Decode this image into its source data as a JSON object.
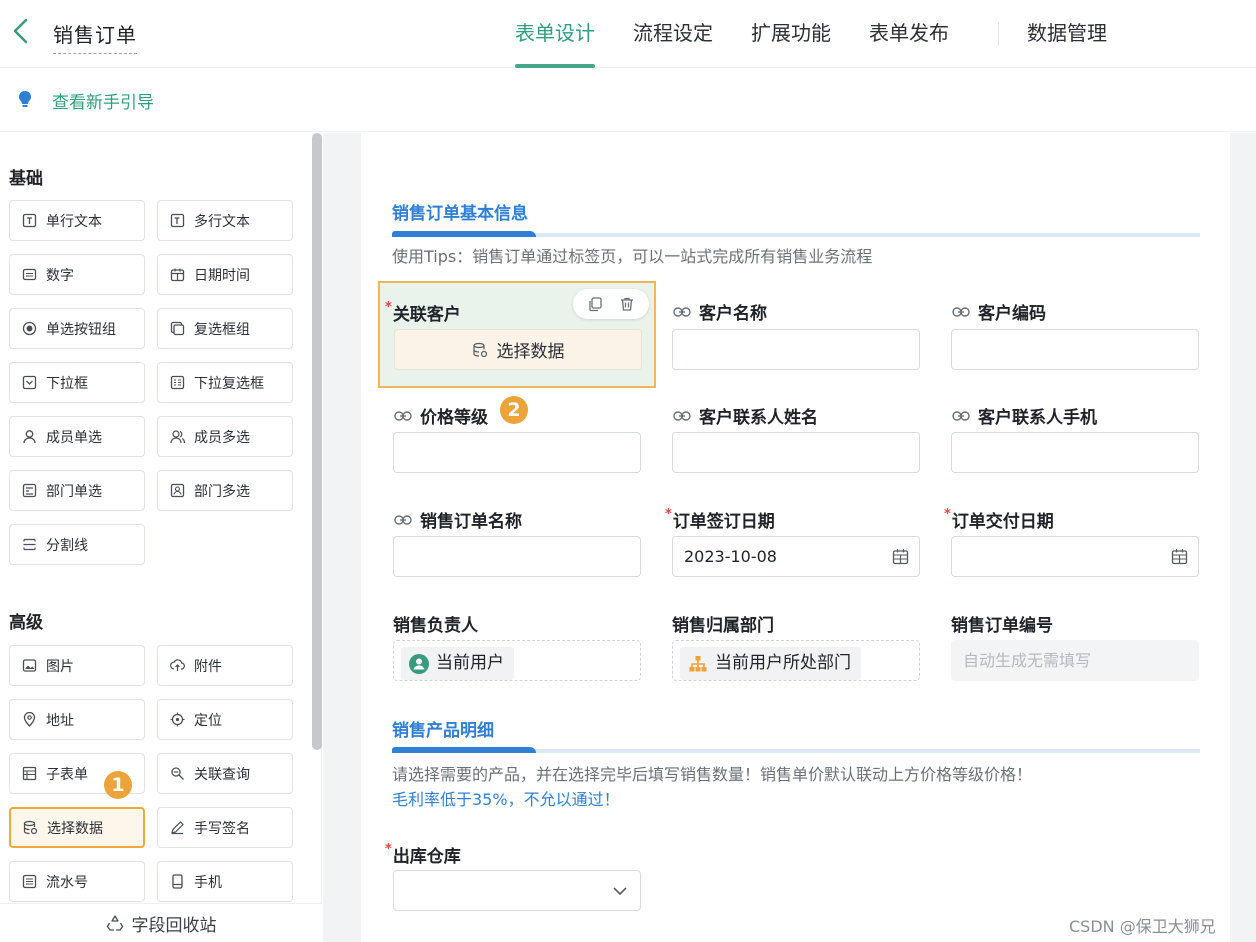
{
  "header": {
    "title": "销售订单",
    "tabs": [
      {
        "label": "表单设计",
        "active": true
      },
      {
        "label": "流程设定"
      },
      {
        "label": "扩展功能"
      },
      {
        "label": "表单发布"
      }
    ],
    "data_tab": "数据管理"
  },
  "guide": {
    "text": "查看新手引导"
  },
  "sidebar": {
    "basic_title": "基础",
    "basic_items": [
      {
        "label": "单行文本",
        "icon": "textbox-icon"
      },
      {
        "label": "多行文本",
        "icon": "textarea-icon"
      },
      {
        "label": "数字",
        "icon": "number-icon"
      },
      {
        "label": "日期时间",
        "icon": "calendar-icon"
      },
      {
        "label": "单选按钮组",
        "icon": "radio-icon"
      },
      {
        "label": "复选框组",
        "icon": "checkbox-group-icon"
      },
      {
        "label": "下拉框",
        "icon": "dropdown-icon"
      },
      {
        "label": "下拉复选框",
        "icon": "multi-dropdown-icon"
      },
      {
        "label": "成员单选",
        "icon": "member-icon"
      },
      {
        "label": "成员多选",
        "icon": "members-icon"
      },
      {
        "label": "部门单选",
        "icon": "department-icon"
      },
      {
        "label": "部门多选",
        "icon": "departments-icon"
      },
      {
        "label": "分割线",
        "icon": "divider-icon"
      }
    ],
    "advanced_title": "高级",
    "advanced_items": [
      {
        "label": "图片",
        "icon": "image-icon"
      },
      {
        "label": "附件",
        "icon": "attachment-icon"
      },
      {
        "label": "地址",
        "icon": "address-icon"
      },
      {
        "label": "定位",
        "icon": "location-icon"
      },
      {
        "label": "子表单",
        "icon": "subform-icon"
      },
      {
        "label": "关联查询",
        "icon": "linked-query-icon"
      },
      {
        "label": "选择数据",
        "icon": "database-icon",
        "selected": true
      },
      {
        "label": "手写签名",
        "icon": "signature-icon"
      },
      {
        "label": "流水号",
        "icon": "serial-number-icon"
      },
      {
        "label": "手机",
        "icon": "phone-icon"
      }
    ],
    "recycle_bin": "字段回收站",
    "step_badge": "1"
  },
  "form": {
    "group1": {
      "title": "销售订单基本信息",
      "tip": "使用Tips：销售订单通过标签页，可以一站式完成所有销售业务流程"
    },
    "fields": {
      "linked_customer": {
        "label": "关联客户",
        "required": true,
        "button": "选择数据"
      },
      "customer_name": {
        "label": "客户名称",
        "value": ""
      },
      "customer_code": {
        "label": "客户编码",
        "value": ""
      },
      "price_level": {
        "label": "价格等级",
        "value": ""
      },
      "contact_name": {
        "label": "客户联系人姓名",
        "value": ""
      },
      "contact_phone": {
        "label": "客户联系人手机",
        "value": ""
      },
      "order_name": {
        "label": "销售订单名称",
        "value": ""
      },
      "sign_date": {
        "label": "订单签订日期",
        "required": true,
        "value": "2023-10-08"
      },
      "delivery_date": {
        "label": "订单交付日期",
        "required": true,
        "value": ""
      },
      "sales_owner": {
        "label": "销售负责人",
        "value": "当前用户"
      },
      "sales_department": {
        "label": "销售归属部门",
        "value": "当前用户所处部门"
      },
      "order_number": {
        "label": "销售订单编号",
        "placeholder": "自动生成无需填写"
      }
    },
    "step_badge": "2",
    "group2": {
      "title": "销售产品明细",
      "tip": "请选择需要的产品，并在选择完毕后填写销售数量！销售单价默认联动上方价格等级价格！",
      "tip_blue": "毛利率低于35%，不允以通过！"
    },
    "warehouse": {
      "label": "出库仓库",
      "required": true,
      "value": ""
    }
  },
  "watermark": "CSDN @保卫大狮兄",
  "colors": {
    "accent": "#2e9f7e",
    "group_blue": "#2f7fd6",
    "highlight": "#efa93a",
    "required": "#e8453c"
  }
}
